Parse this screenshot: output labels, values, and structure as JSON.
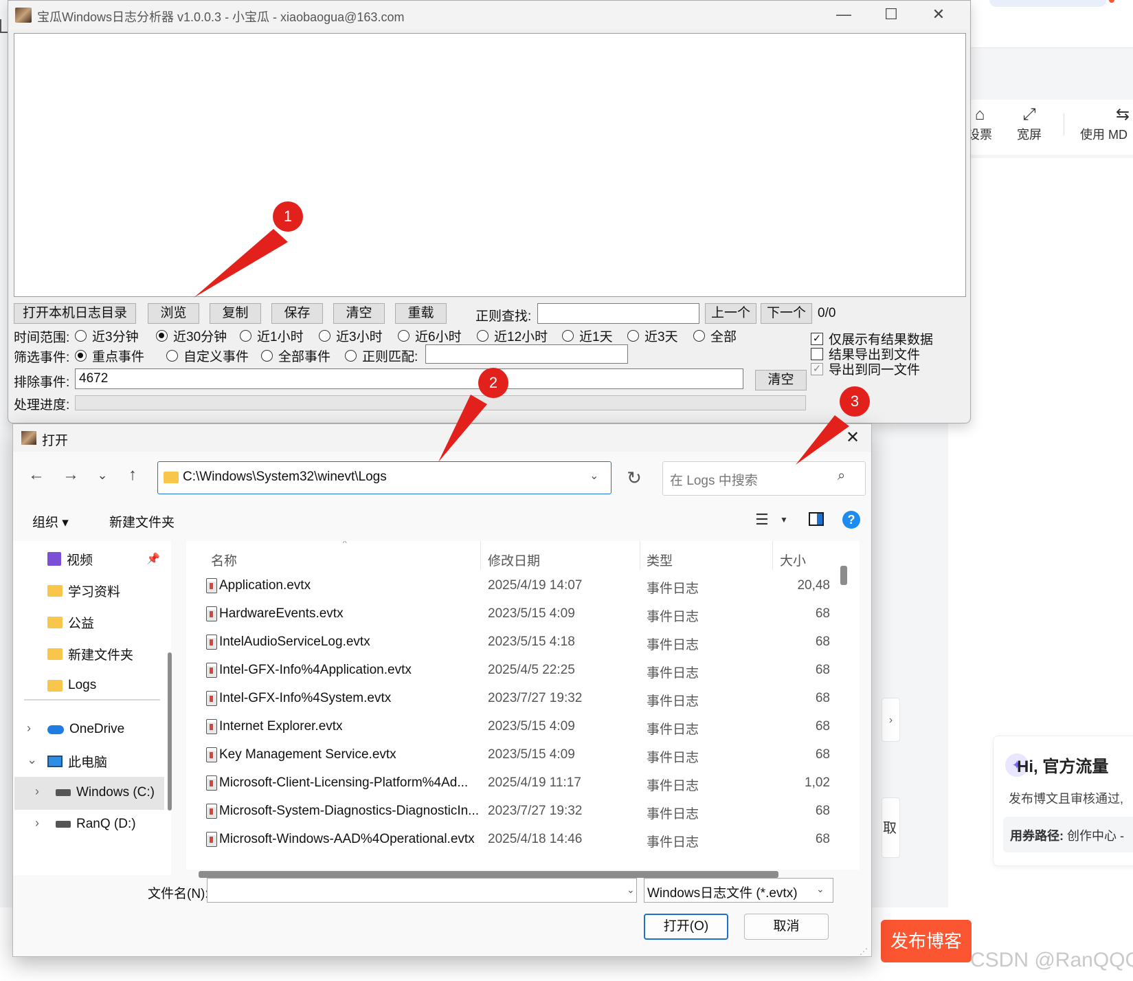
{
  "background": {
    "toolbar": [
      {
        "icon": "vote-icon",
        "label": "投票",
        "shown": "设票"
      },
      {
        "icon": "fullscreen-icon",
        "label": "宽屏"
      },
      {
        "icon": "markdown-icon",
        "label": "使用 MD"
      }
    ],
    "card": {
      "greeting": "Hi, 官方流量",
      "desc": "发布博文且审核通过,",
      "path_label": "用券路径:",
      "path_value": "创作中心 -"
    },
    "side_tab_b": "取",
    "side_tab_a": "›",
    "publish_button": "发布博客",
    "watermark": "CSDN @RanQQQ"
  },
  "analyzer": {
    "title": "宝瓜Windows日志分析器 v1.0.0.3 - 小宝瓜 - xiaobaogua@163.com",
    "window_buttons": {
      "minimize": "—",
      "maximize": "☐",
      "close": "✕"
    },
    "buttons": {
      "open_dir": "打开本机日志目录",
      "browse": "浏览",
      "copy": "复制",
      "save": "保存",
      "clear": "清空",
      "reload": "重载",
      "prev": "上一个",
      "next": "下一个",
      "clear_exclude": "清空"
    },
    "regex_search_label": "正则查找:",
    "regex_search_value": "",
    "match_count": "0/0",
    "time_range_label": "时间范围:",
    "time_options": [
      "近3分钟",
      "近30分钟",
      "近1小时",
      "近3小时",
      "近6小时",
      "近12小时",
      "近1天",
      "近3天",
      "全部"
    ],
    "time_selected": "近30分钟",
    "filter_label": "筛选事件:",
    "filter_options": [
      "重点事件",
      "自定义事件",
      "全部事件",
      "正则匹配:"
    ],
    "filter_selected": "重点事件",
    "regex_match_value": "",
    "exclude_label": "排除事件:",
    "exclude_value": "4672",
    "progress_label": "处理进度:",
    "progress": 0,
    "checkboxes": [
      {
        "label": "仅展示有结果数据",
        "checked": true
      },
      {
        "label": "结果导出到文件",
        "checked": false
      },
      {
        "label": "导出到同一文件",
        "checked": true,
        "disabled": true
      }
    ]
  },
  "dialog": {
    "title": "打开",
    "close": "✕",
    "address": "C:\\Windows\\System32\\winevt\\Logs",
    "search_placeholder": "在 Logs 中搜索",
    "organize": "组织 ▾",
    "new_folder": "新建文件夹",
    "nav_items": [
      {
        "label": "视频",
        "icon": "video-icon",
        "pinned": true
      },
      {
        "label": "学习资料",
        "icon": "folder-icon"
      },
      {
        "label": "公益",
        "icon": "folder-icon"
      },
      {
        "label": "新建文件夹",
        "icon": "folder-icon"
      },
      {
        "label": "Logs",
        "icon": "folder-icon"
      }
    ],
    "tree_items": [
      {
        "label": "OneDrive",
        "icon": "onedrive-icon",
        "chevron": "›"
      },
      {
        "label": "此电脑",
        "icon": "computer-icon",
        "chevron": "⌄"
      },
      {
        "label": "Windows (C:)",
        "icon": "drive-icon",
        "chevron": "›",
        "selected": true
      },
      {
        "label": "RanQ (D:)",
        "icon": "drive-icon",
        "chevron": "›"
      }
    ],
    "columns": [
      "名称",
      "修改日期",
      "类型",
      "大小"
    ],
    "files": [
      {
        "name": "Application.evtx",
        "date": "2025/4/19 14:07",
        "type": "事件日志",
        "size": "20,48"
      },
      {
        "name": "HardwareEvents.evtx",
        "date": "2023/5/15 4:09",
        "type": "事件日志",
        "size": "68"
      },
      {
        "name": "IntelAudioServiceLog.evtx",
        "date": "2023/5/15 4:18",
        "type": "事件日志",
        "size": "68"
      },
      {
        "name": "Intel-GFX-Info%4Application.evtx",
        "date": "2025/4/5 22:25",
        "type": "事件日志",
        "size": "68"
      },
      {
        "name": "Intel-GFX-Info%4System.evtx",
        "date": "2023/7/27 19:32",
        "type": "事件日志",
        "size": "68"
      },
      {
        "name": "Internet Explorer.evtx",
        "date": "2023/5/15 4:09",
        "type": "事件日志",
        "size": "68"
      },
      {
        "name": "Key Management Service.evtx",
        "date": "2023/5/15 4:09",
        "type": "事件日志",
        "size": "68"
      },
      {
        "name": "Microsoft-Client-Licensing-Platform%4Ad...",
        "date": "2025/4/19 11:17",
        "type": "事件日志",
        "size": "1,02"
      },
      {
        "name": "Microsoft-System-Diagnostics-DiagnosticIn...",
        "date": "2023/7/27 19:32",
        "type": "事件日志",
        "size": "68"
      },
      {
        "name": "Microsoft-Windows-AAD%4Operational.evtx",
        "date": "2025/4/18 14:46",
        "type": "事件日志",
        "size": "68"
      }
    ],
    "filename_label": "文件名(N):",
    "filename_value": "",
    "filter_value": "Windows日志文件 (*.evtx)",
    "open_button": "打开(O)",
    "cancel_button": "取消"
  },
  "annotations": [
    "1",
    "2",
    "3"
  ],
  "colors": {
    "annotation": "#e3211c",
    "publish": "#fc5531",
    "accent": "#1a73c8"
  }
}
